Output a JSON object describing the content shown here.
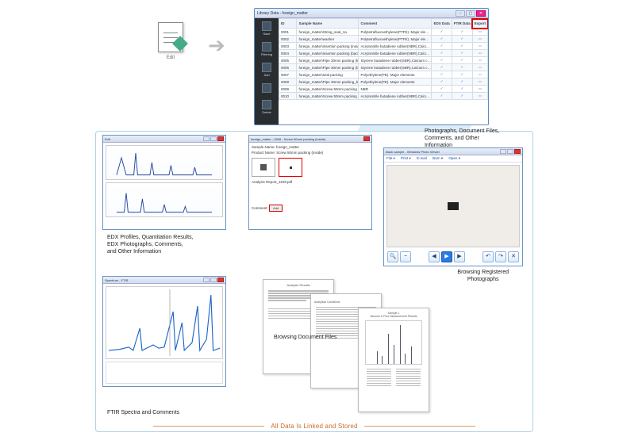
{
  "edit": {
    "label": "Edit"
  },
  "arrow": "➔",
  "library": {
    "title": "Library Data - foreign_matter",
    "columns": [
      "ID",
      "Sample Name",
      "Comment",
      "EDX Data",
      "FTIR Data",
      "Export"
    ],
    "rows": [
      {
        "id": "0001",
        "name": "foreign_matter\\String_seal_1a",
        "comment": "Polytetrafluoroethylene(PTFE). Major ele…"
      },
      {
        "id": "0002",
        "name": "foreign_matter\\washer",
        "comment": "Polytetrafluoroethylene(PTFE). Major ele…"
      },
      {
        "id": "0003",
        "name": "foreign_matter\\insertion packing (inside)",
        "comment": "Acrylonitrile butadiene rubber(NBR),Calci…"
      },
      {
        "id": "0004",
        "name": "foreign_matter\\insertion packing (back)",
        "comment": "Acrylonitrile butadiene rubber(NBR),Calci…"
      },
      {
        "id": "0005",
        "name": "foreign_matter\\Pipe 30mm packing (front)",
        "comment": "Styrene butadiene rubber(SBR),Calcium c…"
      },
      {
        "id": "0006",
        "name": "foreign_matter\\Pipe 30mm packing (back)",
        "comment": "Styrene butadiene rubber(SBR),Calcium c…"
      },
      {
        "id": "0007",
        "name": "foreign_matter\\seal packing",
        "comment": "Polyethylene(PE). Major elements"
      },
      {
        "id": "0008",
        "name": "foreign_matter\\Pipe 30mm packing_b",
        "comment": "Polyethylene(PE). Major elements"
      },
      {
        "id": "0009",
        "name": "foreign_matter\\Screw 50mm packing (front)",
        "comment": "NBR"
      },
      {
        "id": "0010",
        "name": "foreign_matter\\Screw 50mm packing (back)",
        "comment": "Acrylonitrile butadiene rubber(NBR),Calci…"
      }
    ],
    "side": [
      {
        "label": "Save"
      },
      {
        "label": "Filtering"
      },
      {
        "label": "Add"
      },
      {
        "label": ""
      },
      {
        "label": "Delete"
      }
    ]
  },
  "labels": {
    "photos": "Photographs, Document Files,\nComments, and Other\nInformation",
    "edx": "EDX Profiles, Quantitation Results,\nEDX Photographs, Comments,\nand Other Information",
    "ftir": "FTIR Spectra and Comments",
    "docs": "Browsing Document Files",
    "browphoto": "Browsing Registered\nPhotographs"
  },
  "edx": {
    "tabs": "Edit"
  },
  "form": {
    "title": "foreign_matter - 0006 - Screw 50mm packing (inside)",
    "sample_label": "Sample Name:",
    "sample_value": "foreign_matter",
    "product_label": "Product Name:",
    "product_value": "Screw 50mm packing (inside)",
    "analysis_label": "Analysis Report_1109.pdf",
    "comment_label": "Comment:",
    "add_btn": "Add"
  },
  "viewer": {
    "title": "black sample - Windows Photo Viewer",
    "menu": [
      "File ▾",
      "Print ▾",
      "E-mail",
      "Burn ▾",
      "Open ▾"
    ],
    "tools": {
      "zoomout": "−",
      "zoomfit": "⌂",
      "prev": "◀",
      "play": "▶",
      "next": "▶",
      "rotl": "↶",
      "rotr": "↷",
      "del": "✕",
      "zoomin": "🔍"
    }
  },
  "ftir": {
    "title": "Spectrum - FTIR"
  },
  "tagline": "All Data Is Linked and Stored"
}
